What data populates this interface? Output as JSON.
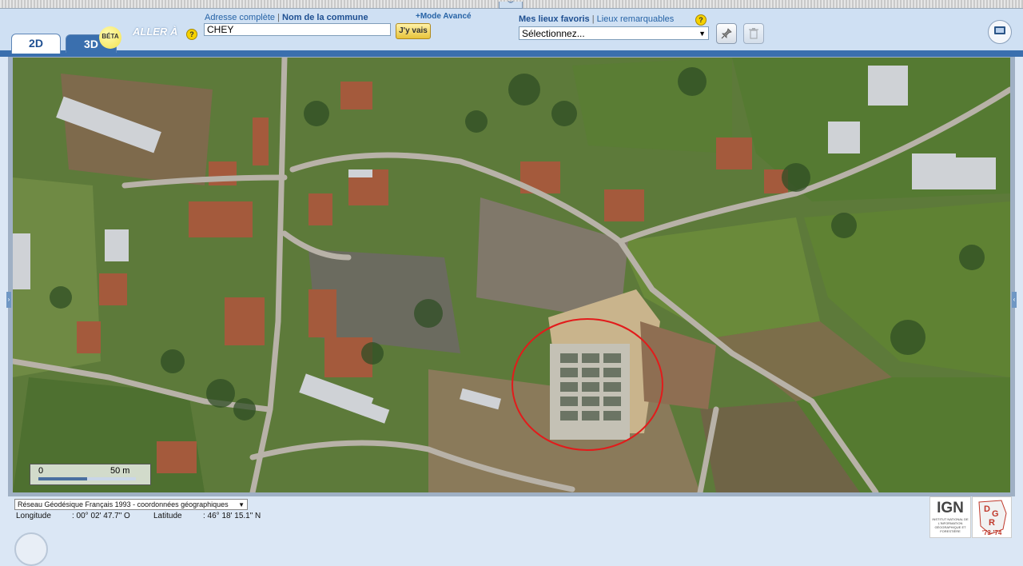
{
  "tabs": {
    "tab_2d": "2D",
    "tab_3d": "3D",
    "beta_badge": "BÉTA"
  },
  "search": {
    "aller_label": "ALLER À",
    "address_link": "Adresse complète",
    "separator": "|",
    "commune_link": "Nom de la commune",
    "advanced_link": "+Mode Avancé",
    "value": "CHEY",
    "go_button": "J'y vais",
    "help": "?"
  },
  "favorites": {
    "mes_lieux": "Mes lieux favoris",
    "separator": "|",
    "lieux_remarquables": "Lieux remarquables",
    "help": "?",
    "select_value": "Sélectionnez..."
  },
  "map": {
    "highlight_color": "#e21b1b",
    "scale_start": "0",
    "scale_end": "50 m"
  },
  "footer": {
    "projection": "Réseau Géodésique Français 1993 - coordonnées géographiques",
    "longitude_label": "Longitude",
    "longitude_value": ": 00° 02' 47.7\" O",
    "latitude_label": "Latitude",
    "latitude_value": ": 46° 18' 15.1\" N"
  },
  "logos": {
    "ign": "IGN",
    "ign_sub": "INSTITUT NATIONAL DE L'INFORMATION GÉOGRAPHIQUE ET FORESTIÈRE",
    "dgr": "DGR",
    "dgr_years": "'73-'74"
  },
  "colors": {
    "toolbar_bg": "#cfe0f3",
    "toolbar_band": "#3a6fae",
    "link_blue": "#2663a6"
  }
}
